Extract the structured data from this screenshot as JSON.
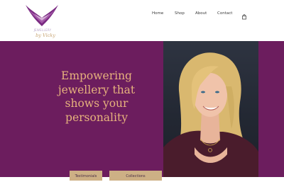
{
  "brand": {
    "tagline_small": "JEWELLERY",
    "script_name": "by Vicky"
  },
  "nav": {
    "items": [
      {
        "label": "Home"
      },
      {
        "label": "Shop"
      },
      {
        "label": "About"
      },
      {
        "label": "Contact"
      }
    ],
    "cart_icon": "shopping-bag-icon"
  },
  "hero": {
    "headline": "Empowering jewellery that shows your personality",
    "buttons": [
      {
        "label": "Testimonials"
      },
      {
        "label": "Collections"
      }
    ]
  },
  "colors": {
    "hero_background": "#6c1d5e",
    "headline": "#e6b27d",
    "button": "#cdb085",
    "logo_purple": "#7a2a82",
    "logo_gold": "#c7a574"
  }
}
